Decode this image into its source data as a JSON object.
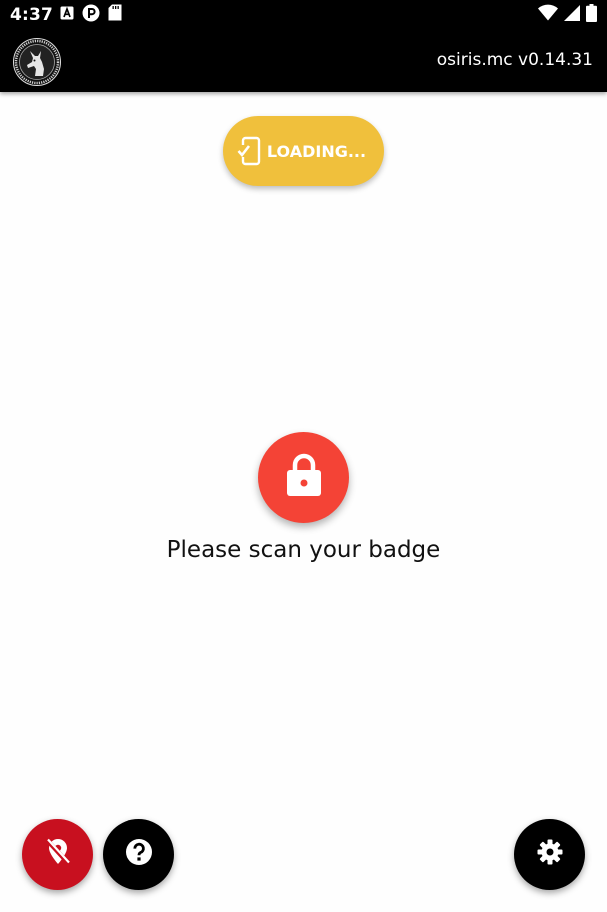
{
  "status_bar": {
    "time": "4:37",
    "left_icons": [
      "notification-a-icon",
      "notification-p-icon",
      "sd-card-icon"
    ],
    "right_icons": [
      "wifi-icon",
      "signal-icon",
      "battery-icon"
    ]
  },
  "app_bar": {
    "logo_icon": "anubis-logo-icon",
    "version": "osiris.mc v0.14.31"
  },
  "loading_chip": {
    "label": "LOADING...",
    "icon": "phone-check-icon",
    "color": "#f0c03c"
  },
  "main": {
    "lock_icon": "lock-icon",
    "lock_color": "#f44336",
    "prompt": "Please scan your badge"
  },
  "fabs": {
    "location_off": {
      "icon": "location-off-icon",
      "color": "#c8101f"
    },
    "help": {
      "icon": "help-icon",
      "color": "#000000"
    },
    "settings": {
      "icon": "gear-icon",
      "color": "#000000"
    }
  }
}
